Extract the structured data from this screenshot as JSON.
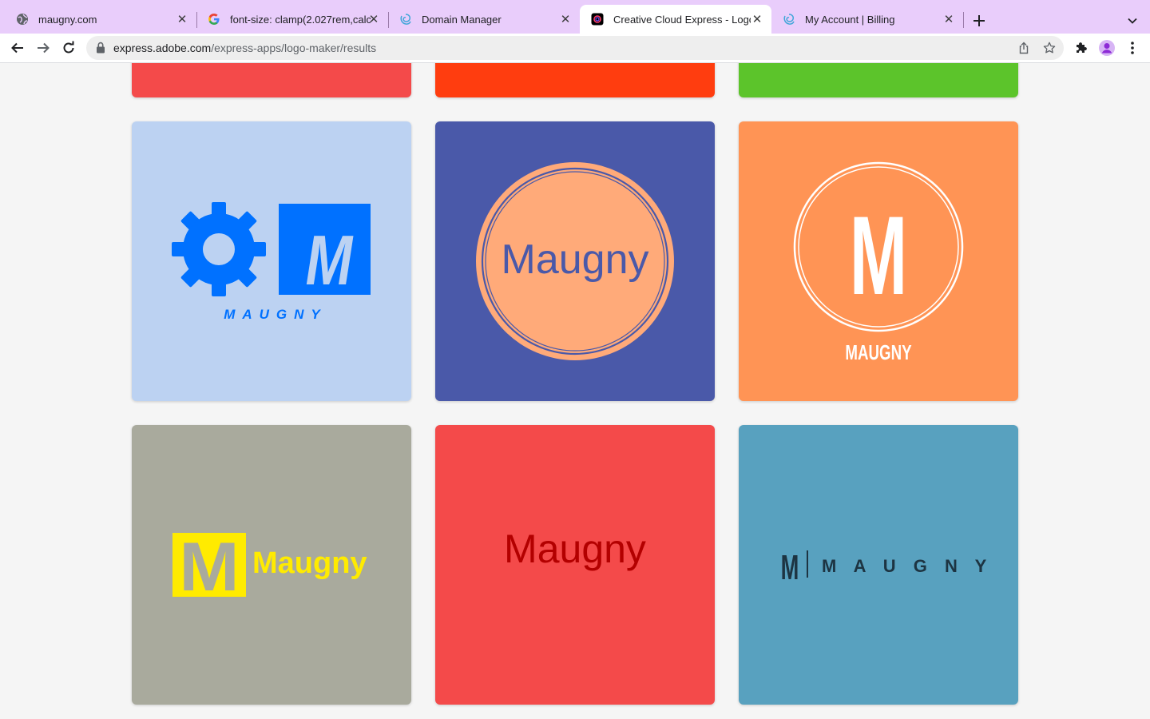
{
  "browser": {
    "tabs": [
      {
        "title": "maugny.com",
        "icon": "globe-icon",
        "active": false
      },
      {
        "title": "font-size: clamp(2.027rem,calc",
        "icon": "google-icon",
        "active": false
      },
      {
        "title": "Domain Manager",
        "icon": "spiral-icon",
        "active": false
      },
      {
        "title": "Creative Cloud Express - Logo",
        "icon": "cc-express-icon",
        "active": true
      },
      {
        "title": "My Account | Billing",
        "icon": "spiral-icon",
        "active": false
      }
    ],
    "url_host": "express.adobe.com",
    "url_path": "/express-apps/logo-maker/results"
  },
  "colors": {
    "tab_strip": "#e9cdfb",
    "page_bg": "#f5f5f5",
    "top_row": [
      "#f44a4a",
      "#ff3d0f",
      "#5cc42b"
    ],
    "light_blue": "#bcd2f2",
    "indigo": "#4a59a9",
    "orange": "#ff9455",
    "gray": "#a9aa9d",
    "red": "#f44a4a",
    "steel_blue": "#58a1bf"
  },
  "logos": {
    "gear_mark": "M",
    "gear_name": "MAUGNY",
    "circle_name": "Maugny",
    "orange_mark": "M",
    "orange_name": "MAUGNY",
    "yellow_mark": "M",
    "yellow_name": "Maugny",
    "red_name": "Maugny",
    "steel_mark": "M",
    "steel_name": "M A U G N Y"
  }
}
